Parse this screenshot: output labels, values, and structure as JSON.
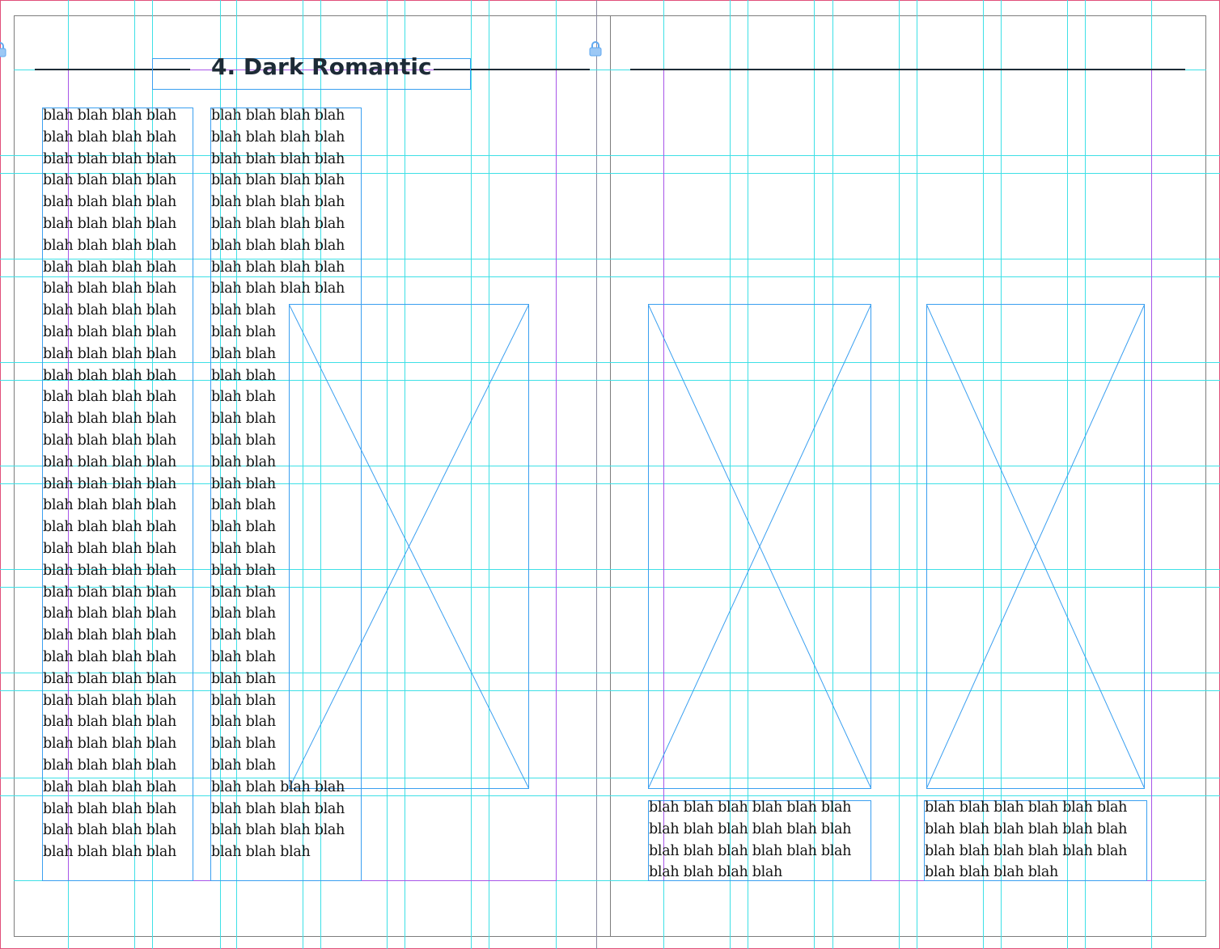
{
  "document": {
    "heading": "4. Dark Romantic",
    "placeholder_word": "blah"
  },
  "left_page": {
    "column1_lines": [
      "blah blah blah blah",
      "blah blah blah blah",
      "blah blah blah blah",
      "blah blah blah blah",
      "blah blah blah blah",
      "blah blah blah blah",
      "blah blah blah blah",
      "blah blah blah blah",
      "blah blah blah blah",
      "blah blah blah blah",
      "blah blah blah blah",
      "blah blah blah blah",
      "blah blah blah blah",
      "blah blah blah blah",
      "blah blah blah blah",
      "blah blah blah blah",
      "blah blah blah blah",
      "blah blah blah blah",
      "blah blah blah blah",
      "blah blah blah blah",
      "blah blah blah blah",
      "blah blah blah blah",
      "blah blah blah blah",
      "blah blah blah blah",
      "blah blah blah blah",
      "blah blah blah blah",
      "blah blah blah blah",
      "blah blah blah blah",
      "blah blah blah blah",
      "blah blah blah blah",
      "blah blah blah blah",
      "blah blah blah blah",
      "blah blah blah blah",
      "blah blah blah blah",
      "blah blah blah blah"
    ],
    "column2_lines": [
      "blah blah blah blah",
      "blah blah blah blah",
      "blah blah blah blah",
      "blah blah blah blah",
      "blah blah blah blah",
      "blah blah blah blah",
      "blah blah blah blah",
      "blah blah blah blah",
      "blah blah blah blah",
      "blah blah",
      "blah blah",
      "blah blah",
      "blah blah",
      "blah blah",
      "blah blah",
      "blah blah",
      "blah blah",
      "blah blah",
      "blah blah",
      "blah blah",
      "blah blah",
      "blah blah",
      "blah blah",
      "blah blah",
      "blah blah",
      "blah blah",
      "blah blah",
      "blah blah",
      "blah blah",
      "blah blah",
      "blah blah",
      "blah blah blah blah",
      "blah blah blah blah",
      "blah blah blah blah",
      "blah blah blah"
    ]
  },
  "right_page": {
    "caption1_lines": [
      "blah blah blah blah blah blah",
      "blah blah blah blah blah blah",
      "blah blah blah blah blah blah",
      "blah blah blah blah"
    ],
    "caption2_lines": [
      "blah blah blah blah blah blah",
      "blah blah blah blah blah blah",
      "blah blah blah blah blah blah",
      "blah blah blah blah"
    ]
  },
  "colors": {
    "guide": "#3ee0e6",
    "margin": "#a855e8",
    "frame": "#3a9ff0",
    "bleed": "#e0507a",
    "heading_rule": "#1d2b36"
  },
  "icons": [
    "lock-icon"
  ]
}
